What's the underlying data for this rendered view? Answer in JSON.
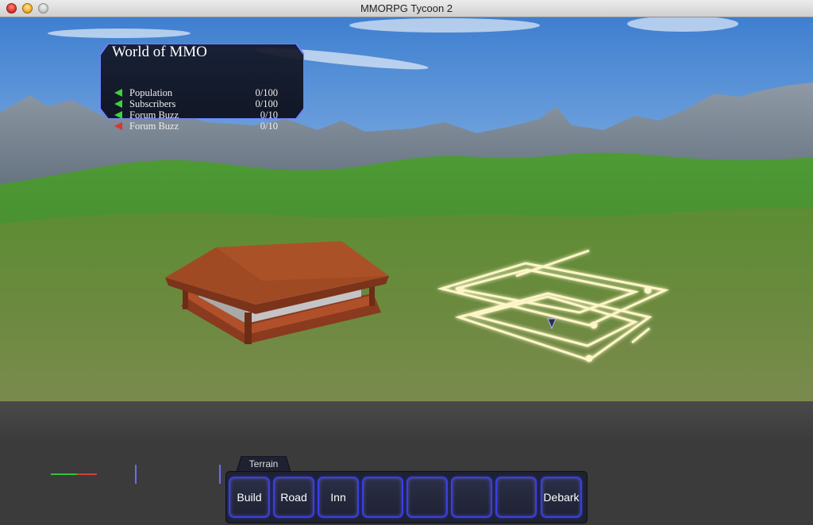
{
  "window": {
    "title": "MMORPG Tycoon 2"
  },
  "hud": {
    "title": "World of MMO",
    "stats": [
      {
        "label": "Population",
        "value": "0/100",
        "trend": "up",
        "trend_color": "#3fd23a"
      },
      {
        "label": "Subscribers",
        "value": "0/100",
        "trend": "up",
        "trend_color": "#3fd23a"
      },
      {
        "label": "Forum Buzz",
        "value": "0/10",
        "trend": "up",
        "trend_color": "#3fd23a"
      },
      {
        "label": "Forum Buzz",
        "value": "0/10",
        "trend": "down",
        "trend_color": "#e0332c"
      }
    ]
  },
  "toolbar": {
    "tab_label": "Terrain",
    "slots": [
      "Build",
      "Road",
      "Inn",
      "",
      "",
      "",
      "",
      "Debark"
    ]
  },
  "colors": {
    "sky_top": "#3f7fd0",
    "grass": "#4f8f2e",
    "roof": "#a04a24",
    "slot_border": "#3a3ee6",
    "placement_glow": "#fff6c8"
  },
  "icons": {
    "stat_up": "green-left-arrow-icon",
    "stat_down": "red-left-arrow-icon",
    "cursor": "cursor-icon"
  }
}
